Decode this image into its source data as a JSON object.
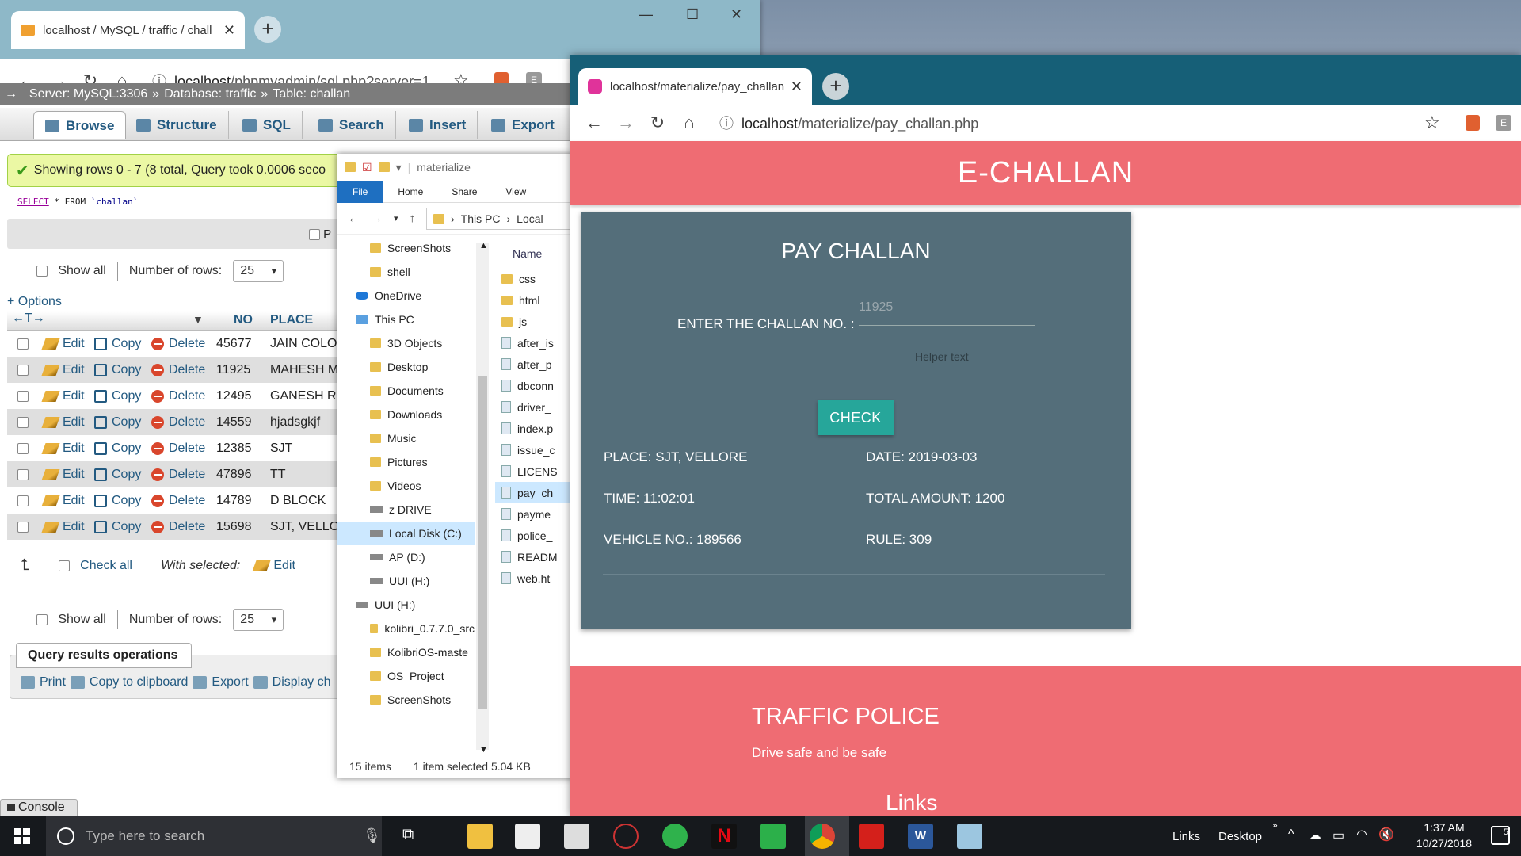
{
  "pma_window": {
    "tab_title": "localhost / MySQL / traffic / chall",
    "url_host": "localhost",
    "url_path": "/phpmyadmin/sql.php?server=1...",
    "breadcrumb": [
      "Server: MySQL:3306",
      "Database: traffic",
      "Table: challan"
    ],
    "tabs": [
      "Browse",
      "Structure",
      "SQL",
      "Search",
      "Insert",
      "Export"
    ],
    "success_message": "Showing rows 0 - 7 (8 total, Query took 0.0006 seco",
    "sql": {
      "kw": "SELECT",
      "rest": " * FROM ",
      "table": "`challan`"
    },
    "profile_label": "P",
    "show_all": "Show all",
    "number_of_rows": "Number of rows:",
    "rows_value": "25",
    "options": "+ Options",
    "col_no": "NO",
    "col_place": "PLACE",
    "action_edit": "Edit",
    "action_copy": "Copy",
    "action_delete": "Delete",
    "rows": [
      {
        "no": "45677",
        "place": "JAIN COLO"
      },
      {
        "no": "11925",
        "place": "MAHESH M"
      },
      {
        "no": "12495",
        "place": "GANESH R"
      },
      {
        "no": "14559",
        "place": "hjadsgkjf"
      },
      {
        "no": "12385",
        "place": "SJT"
      },
      {
        "no": "47896",
        "place": "TT"
      },
      {
        "no": "14789",
        "place": "D BLOCK"
      },
      {
        "no": "15698",
        "place": "SJT, VELLO"
      }
    ],
    "check_all": "Check all",
    "with_selected": "With selected:",
    "with_selected_edit": "Edit",
    "qro_title": "Query results operations",
    "qro_print": "Print",
    "qro_copy": "Copy to clipboard",
    "qro_export": "Export",
    "qro_display": "Display ch",
    "console": "Console"
  },
  "explorer": {
    "title": "materialize",
    "ribbon": [
      "File",
      "Home",
      "Share",
      "View"
    ],
    "path": [
      "This PC",
      "Local"
    ],
    "tree": [
      "ScreenShots",
      "shell",
      "OneDrive",
      "This PC",
      "3D Objects",
      "Desktop",
      "Documents",
      "Downloads",
      "Music",
      "Pictures",
      "Videos",
      "z DRIVE",
      "Local Disk (C:)",
      "AP (D:)",
      "UUI (H:)",
      "UUI (H:)",
      "kolibri_0.7.7.0_src",
      "KolibriOS-maste",
      "OS_Project",
      "ScreenShots"
    ],
    "name_header": "Name",
    "files": [
      "css",
      "html",
      "js",
      "after_is",
      "after_p",
      "dbconn",
      "driver_",
      "index.p",
      "issue_c",
      "LICENS",
      "pay_ch",
      "payme",
      "police_",
      "READM",
      "web.ht"
    ],
    "status_items": "15 items",
    "status_selected": "1 item selected  5.04 KB"
  },
  "echallan_window": {
    "tab_title": "localhost/materialize/pay_challan",
    "url_host": "localhost",
    "url_path": "/materialize/pay_challan.php",
    "brand": "E-CHALLAN",
    "card_title": "PAY CHALLAN",
    "input_label": "ENTER THE CHALLAN NO. :",
    "input_placeholder": "11925",
    "helper_text": "Helper text",
    "check_button": "CHECK",
    "place": "PLACE: SJT, VELLORE",
    "date": "DATE: 2019-03-03",
    "time": "TIME: 11:02:01",
    "total": "TOTAL AMOUNT: 1200",
    "vehicle": "VEHICLE NO.: 189566",
    "rule": "RULE: 309",
    "footer_title": "TRAFFIC POLICE",
    "footer_text": "Drive safe and be safe",
    "footer_links": "Links",
    "accent": "#ef6c73",
    "card_color": "#546e7a",
    "button_color": "#26a69a"
  },
  "taskbar": {
    "search_placeholder": "Type here to search",
    "links": "Links",
    "desktop": "Desktop",
    "time": "1:37 AM",
    "date": "10/27/2018",
    "notif_count": "5"
  }
}
